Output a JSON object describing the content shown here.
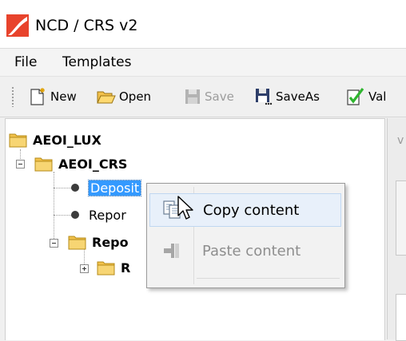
{
  "window": {
    "title": "NCD / CRS v2",
    "logo_icon": "app-logo-icon",
    "logo_color": "#e8432c"
  },
  "menu": {
    "items": [
      "File",
      "Templates"
    ]
  },
  "toolbar": {
    "new_label": "New",
    "open_label": "Open",
    "save_label": "Save",
    "saveas_label": "SaveAs",
    "validate_label": "Val"
  },
  "tree": {
    "root": "AEOI_LUX",
    "crs": "AEOI_CRS",
    "deposit": "Deposit",
    "report1": "Repor",
    "reporting": "Repo",
    "r_node": "R"
  },
  "right_panel": {
    "label": "v"
  },
  "context_menu": {
    "copy_label": "Copy content",
    "paste_label": "Paste content"
  },
  "colors": {
    "selection": "#3399ff",
    "folder": "#f2c24b",
    "menu_hover": "#e8f0fa"
  }
}
